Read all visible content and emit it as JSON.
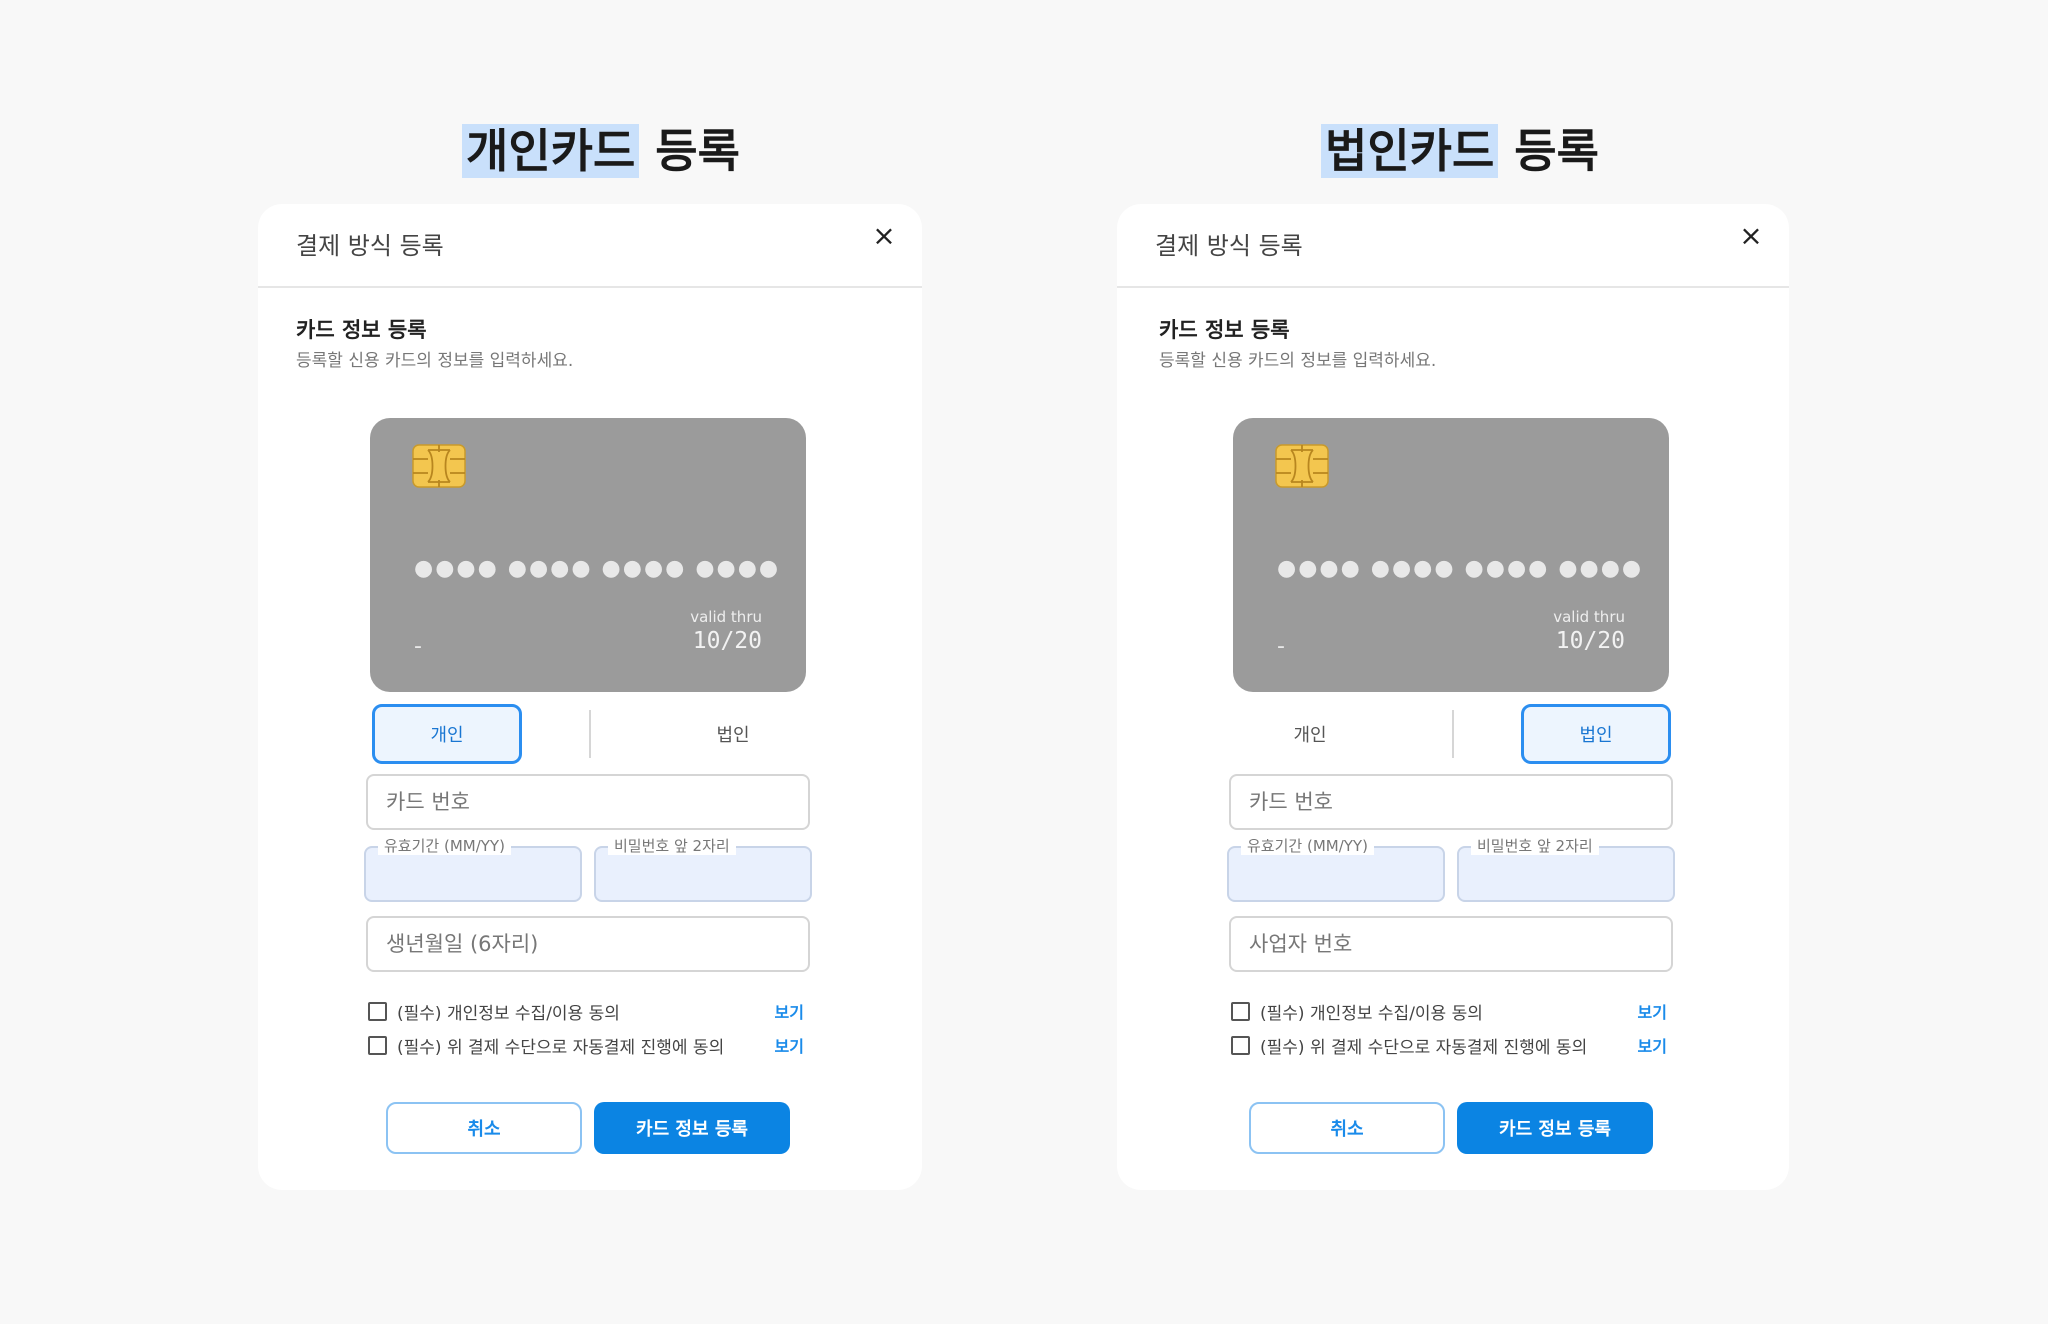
{
  "panels": [
    {
      "heading_highlight": "개인카드",
      "heading_rest": " 등록",
      "modal_title": "결제 방식 등록",
      "close_label": "×",
      "section_title": "카드 정보 등록",
      "section_desc": "등록할 신용 카드의 정보를 입력하세요.",
      "card": {
        "number_mask": "●●●● ●●●● ●●●● ●●●●",
        "holder": "-",
        "valid_label": "valid thru",
        "valid_value": "10/20"
      },
      "toggle": {
        "left": "개인",
        "right": "법인",
        "active": "left"
      },
      "card_no_placeholder": "카드 번호",
      "expiry_label": "유효기간 (MM/YY)",
      "password_label": "비밀번호 앞 2자리",
      "id_placeholder": "생년월일 (6자리)",
      "agreements": [
        {
          "text": "(필수) 개인정보 수집/이용 동의",
          "link": "보기",
          "checked": false
        },
        {
          "text": "(필수) 위 결제 수단으로 자동결제 진행에 동의",
          "link": "보기",
          "checked": false
        }
      ],
      "cancel_label": "취소",
      "submit_label": "카드 정보 등록"
    },
    {
      "heading_highlight": "법인카드",
      "heading_rest": " 등록",
      "modal_title": "결제 방식 등록",
      "close_label": "×",
      "section_title": "카드 정보 등록",
      "section_desc": "등록할 신용 카드의 정보를 입력하세요.",
      "card": {
        "number_mask": "●●●● ●●●● ●●●● ●●●●",
        "holder": "-",
        "valid_label": "valid thru",
        "valid_value": "10/20"
      },
      "toggle": {
        "left": "개인",
        "right": "법인",
        "active": "right"
      },
      "card_no_placeholder": "카드 번호",
      "expiry_label": "유효기간 (MM/YY)",
      "password_label": "비밀번호 앞 2자리",
      "id_placeholder": "사업자 번호",
      "agreements": [
        {
          "text": "(필수) 개인정보 수집/이용 동의",
          "link": "보기",
          "checked": false
        },
        {
          "text": "(필수) 위 결제 수단으로 자동결제 진행에 동의",
          "link": "보기",
          "checked": false
        }
      ],
      "cancel_label": "취소",
      "submit_label": "카드 정보 등록"
    }
  ],
  "colors": {
    "accent": "#0b84e3",
    "highlight": "#c9e0fb",
    "card_bg": "#9b9b9b",
    "field_fill": "#e9f0fd"
  }
}
